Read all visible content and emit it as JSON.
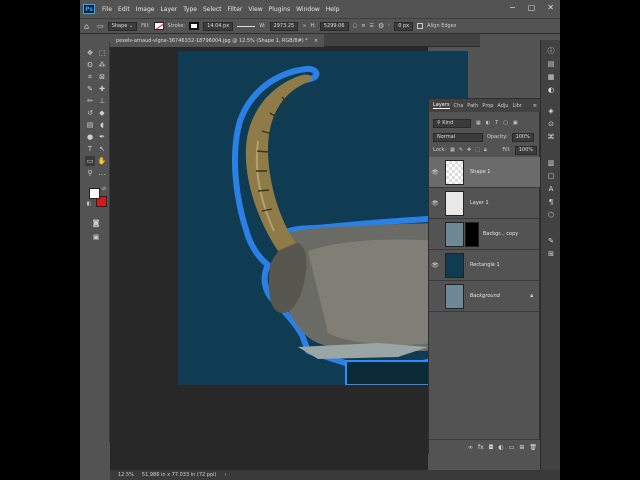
{
  "menubar": {
    "logo": "Ps",
    "items": [
      "File",
      "Edit",
      "Image",
      "Layer",
      "Type",
      "Select",
      "Filter",
      "View",
      "Plugins",
      "Window",
      "Help"
    ]
  },
  "window_controls": [
    "−",
    "▢",
    "✕"
  ],
  "options": {
    "shape_mode": "Shape",
    "fill_label": "Fill:",
    "stroke_label": "Stroke:",
    "stroke_width": "14.04 px",
    "w_label": "W:",
    "w_value": "2973.25",
    "h_label": "H:",
    "h_value": "5299.06",
    "angle": "0 px",
    "align_edges": "Align Edges"
  },
  "document": {
    "tab_title": "pexels-arnaud-vigne-36746332-18796004.jpg @ 12.5% (Shape 1, RGB/8#) *",
    "close": "×"
  },
  "status": {
    "zoom": "12.5%",
    "info": "51.986 in x 77.033 in (72 ppi)"
  },
  "layers_panel": {
    "tabs": [
      "Layers",
      "Cha",
      "Path",
      "Prop",
      "Adju",
      "Libr"
    ],
    "filter_kind": "Kind",
    "blend_mode": "Normal",
    "opacity_label": "Opacity:",
    "opacity_value": "100%",
    "lock_label": "Lock:",
    "fill_label": "Fill:",
    "fill_value": "100%",
    "layers": [
      {
        "name": "Shape 1"
      },
      {
        "name": "Layer 1"
      },
      {
        "name": "Backgr... copy"
      },
      {
        "name": "Rectangle 1"
      },
      {
        "name": "Background"
      }
    ]
  },
  "colors": {
    "doc_bg": "#0f3c52",
    "foreground": "#ffffff",
    "background": "#d11a1a",
    "highlight": "#2f8cff"
  }
}
